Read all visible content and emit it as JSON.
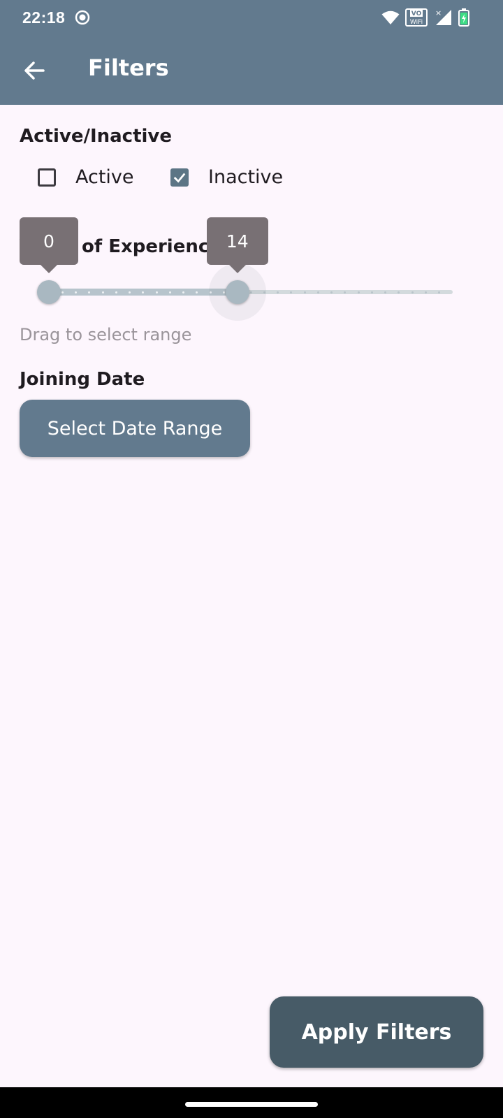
{
  "status_bar": {
    "time": "22:18",
    "icons": [
      "record-icon",
      "wifi-icon",
      "vowifi-icon",
      "signal-icon",
      "battery-charging-icon"
    ]
  },
  "app_bar": {
    "title": "Filters",
    "back_icon": "arrow-left-icon"
  },
  "active_section": {
    "title": "Active/Inactive",
    "options": [
      {
        "label": "Active",
        "checked": false
      },
      {
        "label": "Inactive",
        "checked": true
      }
    ]
  },
  "experience_section": {
    "title": "Years of Experience",
    "range": {
      "min": 0,
      "max": 30,
      "low": 0,
      "high": 14
    },
    "low_label": "0",
    "high_label": "14",
    "hint": "Drag to select range"
  },
  "joining_section": {
    "title": "Joining Date",
    "button_label": "Select Date Range"
  },
  "apply_button": {
    "label": "Apply Filters"
  },
  "colors": {
    "primary": "#627a8e",
    "apply": "#475b67",
    "background": "#fdf6fd",
    "slider_active": "#b7c4cc",
    "slider_inactive": "#d3dadd",
    "tooltip": "#787074"
  }
}
